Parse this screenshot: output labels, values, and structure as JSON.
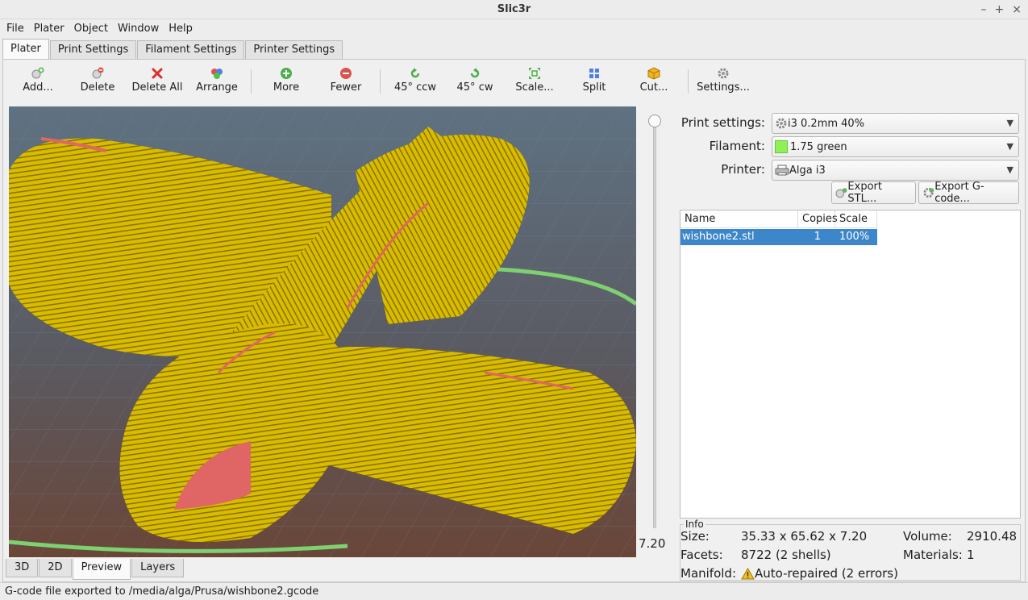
{
  "window": {
    "title": "Slic3r",
    "controls": [
      "–",
      "+",
      "×"
    ]
  },
  "menu": [
    "File",
    "Plater",
    "Object",
    "Window",
    "Help"
  ],
  "tabs": [
    {
      "label": "Plater",
      "active": true
    },
    {
      "label": "Print Settings",
      "active": false
    },
    {
      "label": "Filament Settings",
      "active": false
    },
    {
      "label": "Printer Settings",
      "active": false
    }
  ],
  "toolbar": {
    "add": "Add...",
    "delete": "Delete",
    "delete_all": "Delete All",
    "arrange": "Arrange",
    "more": "More",
    "fewer": "Fewer",
    "rotate_ccw": "45° ccw",
    "rotate_cw": "45° cw",
    "scale": "Scale...",
    "split": "Split",
    "cut": "Cut...",
    "settings": "Settings..."
  },
  "preview": {
    "layer_height_value": "7.20",
    "colors": {
      "perimeter": "#e0c600",
      "infill": "#e06666",
      "skirt": "#7fd070",
      "bed_top": "#5e6e7c",
      "bed_bottom": "#6e4a3c"
    }
  },
  "view_tabs": [
    {
      "label": "3D",
      "active": false
    },
    {
      "label": "2D",
      "active": false
    },
    {
      "label": "Preview",
      "active": true
    },
    {
      "label": "Layers",
      "active": false
    }
  ],
  "settings": {
    "print_label": "Print settings:",
    "print_value": "i3 0.2mm 40%",
    "filament_label": "Filament:",
    "filament_value": "1.75 green",
    "filament_color": "#8ff05a",
    "printer_label": "Printer:",
    "printer_value": "Alga i3"
  },
  "export": {
    "stl": "Export STL...",
    "gcode": "Export G-code..."
  },
  "objects": {
    "headers": {
      "name": "Name",
      "copies": "Copies",
      "scale": "Scale"
    },
    "rows": [
      {
        "name": "wishbone2.stl",
        "copies": "1",
        "scale": "100%"
      }
    ]
  },
  "info": {
    "title": "Info",
    "size_label": "Size:",
    "size_value": "35.33 x 65.62 x 7.20",
    "volume_label": "Volume:",
    "volume_value": "2910.48",
    "facets_label": "Facets:",
    "facets_value": "8722 (2 shells)",
    "materials_label": "Materials:",
    "materials_value": "1",
    "manifold_label": "Manifold:",
    "manifold_value": "Auto-repaired (2 errors)"
  },
  "status": "G-code file exported to /media/alga/Prusa/wishbone2.gcode"
}
